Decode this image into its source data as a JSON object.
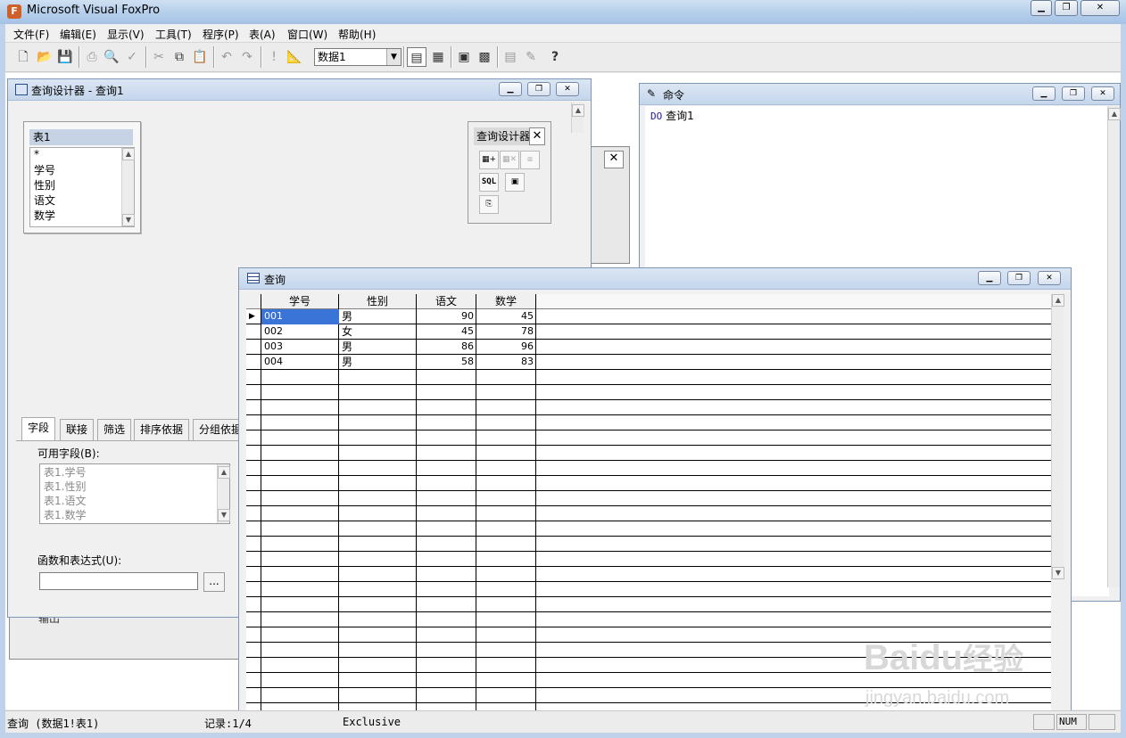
{
  "app": {
    "title": "Microsoft Visual FoxPro",
    "icon": "fox-icon"
  },
  "menu": [
    "文件(F)",
    "编辑(E)",
    "显示(V)",
    "工具(T)",
    "程序(P)",
    "表(A)",
    "窗口(W)",
    "帮助(H)"
  ],
  "toolbar": {
    "datasession": "数据1"
  },
  "query_designer": {
    "title": "查询设计器 - 查询1",
    "table_name": "表1",
    "table_fields": [
      "*",
      "学号",
      "性别",
      "语文",
      "数学"
    ],
    "toolbox_title": "查询设计器",
    "sql_label": "SQL",
    "tabs": [
      "字段",
      "联接",
      "筛选",
      "排序依据",
      "分组依据"
    ],
    "available_fields_label": "可用字段(B):",
    "available_fields": [
      "表1.学号",
      "表1.性别",
      "表1.语文",
      "表1.数学"
    ],
    "expr_label": "函数和表达式(U):",
    "expr_button": "...",
    "hidden_label": "输出"
  },
  "command_window": {
    "title": "命令",
    "lines": [
      {
        "kw": "DO",
        "arg": "查询1"
      }
    ]
  },
  "query_result": {
    "title": "查询",
    "columns": [
      "学号",
      "性别",
      "语文",
      "数学"
    ],
    "rows": [
      [
        "001",
        "男",
        "90",
        "45"
      ],
      [
        "002",
        "女",
        "45",
        "78"
      ],
      [
        "003",
        "男",
        "86",
        "96"
      ],
      [
        "004",
        "男",
        "58",
        "83"
      ]
    ]
  },
  "statusbar": {
    "alias": "查询 (数据1!表1)",
    "record": "记录:1/4",
    "mode": "Exclusive",
    "num": "NUM"
  },
  "watermark": {
    "brand": "Baidu",
    "cn": "经验",
    "url": "jingyan.baidu.com"
  }
}
